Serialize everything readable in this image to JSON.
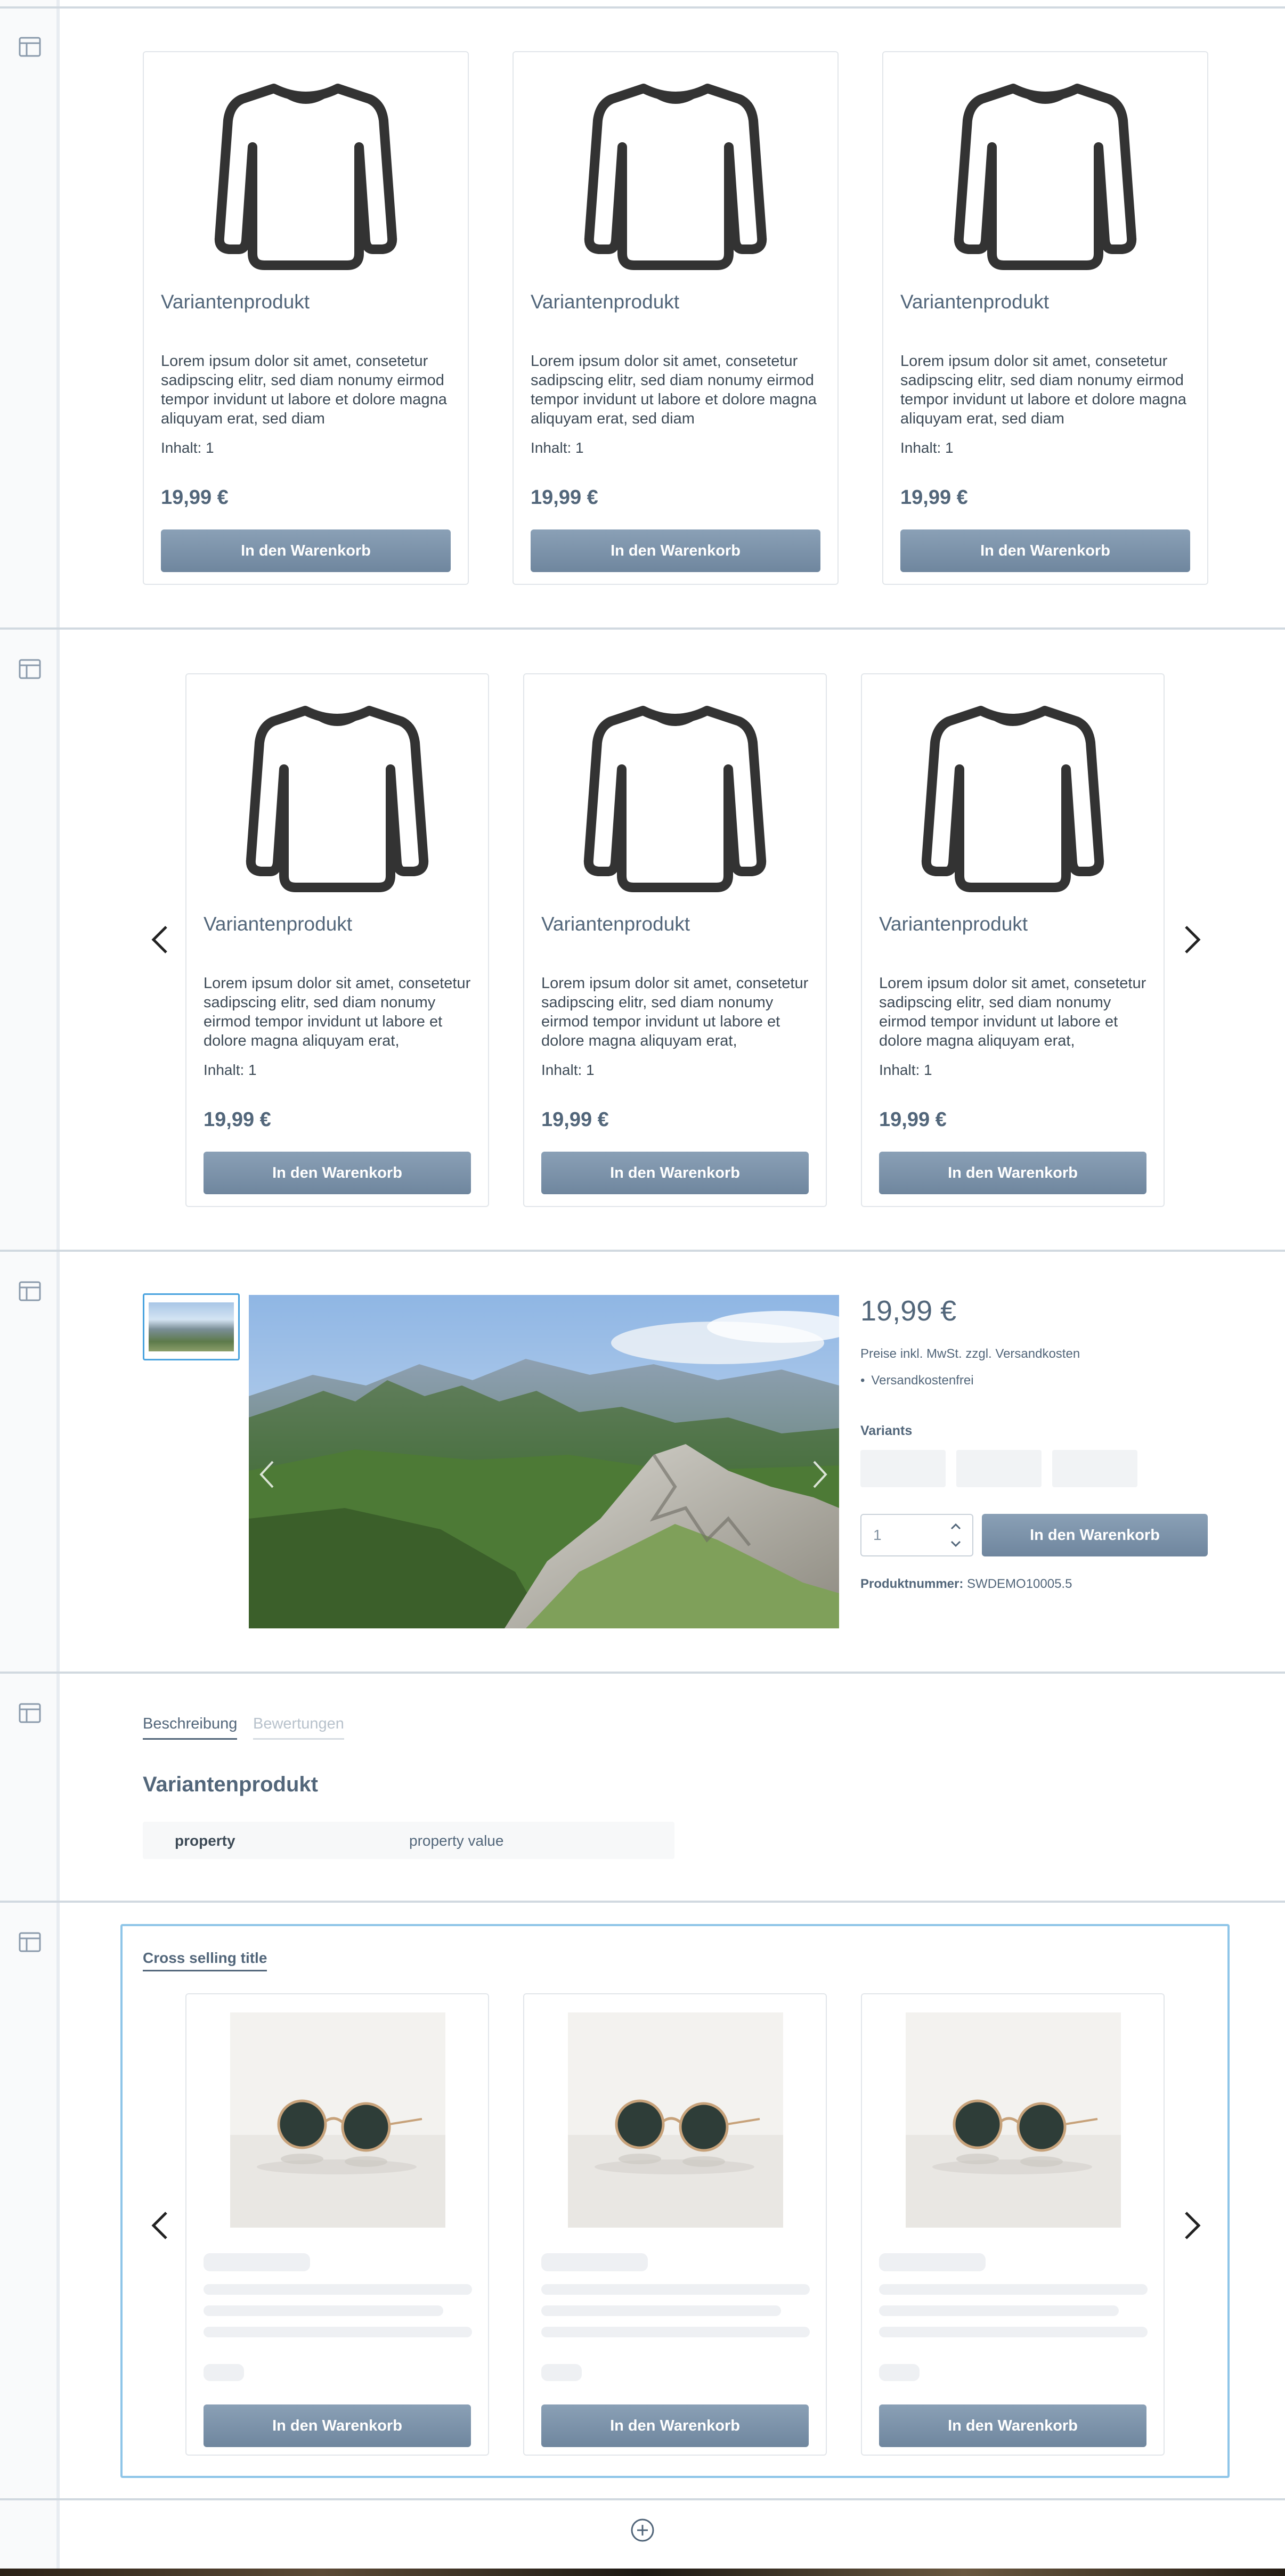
{
  "product_card": {
    "name": "Variantenprodukt",
    "description": "Lorem ipsum dolor sit amet, consetetur sadipscing elitr, sed diam nonumy eirmod tempor invidunt ut labore et dolore magna aliquyam erat, sed diam",
    "inhalt": "Inhalt: 1",
    "price": "19,99 €",
    "button": "In den Warenkorb"
  },
  "product_card_slider": {
    "name": "Variantenprodukt",
    "description": "Lorem ipsum dolor sit amet, consetetur sadipscing elitr, sed diam nonumy eirmod tempor invidunt ut labore et dolore magna aliquyam erat,",
    "inhalt": "Inhalt: 1",
    "price": "19,99 €",
    "button": "In den Warenkorb"
  },
  "buy_box": {
    "price": "19,99 €",
    "tax_note": "Preise inkl. MwSt. zzgl. Versandkosten",
    "shipping": "Versandkostenfrei",
    "variants_label": "Variants",
    "quantity": "1",
    "button": "In den Warenkorb",
    "sku_label": "Produktnummer:",
    "sku_value": "SWDEMO10005.5"
  },
  "description_tabs": {
    "tabs": [
      "Beschreibung",
      "Bewertungen"
    ],
    "title": "Variantenprodukt",
    "property_key": "property",
    "property_value": "property value"
  },
  "cross_selling": {
    "title": "Cross selling title",
    "button": "In den Warenkorb"
  },
  "icons": {
    "block": "layout-icon",
    "prev": "chevron-left-icon",
    "next": "chevron-right-icon",
    "add": "plus-circle-icon",
    "product_placeholder": "shirt-icon"
  },
  "colors": {
    "accent": "#52667a",
    "button": "#7b92a9",
    "selection": "#4aa3df",
    "border": "#e2e6ea"
  }
}
